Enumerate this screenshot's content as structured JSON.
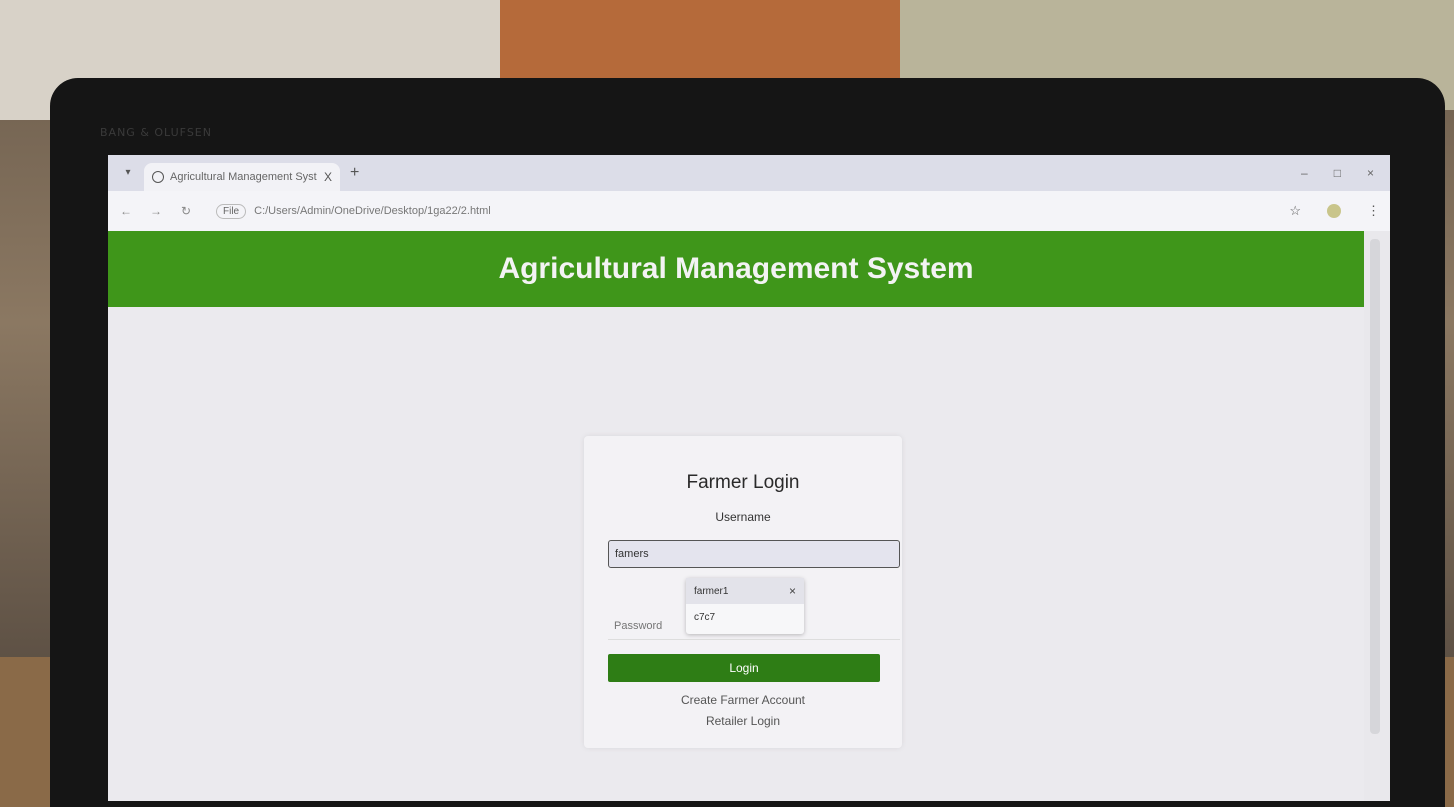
{
  "laptop": {
    "brand": "BANG & OLUFSEN"
  },
  "browser": {
    "tab_title": "Agricultural Management Syst",
    "tab_close": "X",
    "new_tab": "+",
    "address": "C:/Users/Admin/OneDrive/Desktop/1ga22/2.html",
    "file_chip": "File",
    "win_min": "–",
    "win_max": "□",
    "win_close": "×"
  },
  "header": {
    "title": "Agricultural Management System"
  },
  "login_card": {
    "title": "Farmer Login",
    "username_label": "Username",
    "username_value": "famers",
    "password_placeholder": "Password",
    "login_button": "Login",
    "create_link": "Create Farmer Account",
    "retailer_link": "Retailer Login"
  },
  "autocomplete": {
    "items": [
      "farmer1",
      "c7c7"
    ],
    "remove": "×"
  }
}
